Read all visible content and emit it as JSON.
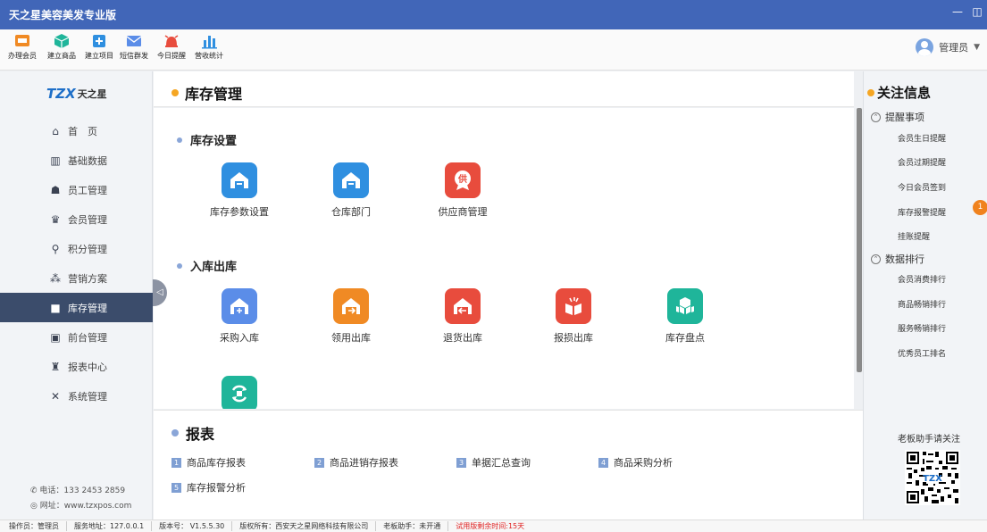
{
  "window": {
    "title": "天之星美容美发专业版",
    "min_label": "—",
    "restore_label": "◫"
  },
  "toolbar": {
    "items": [
      {
        "label": "办理会员",
        "icon": "vip-card-icon"
      },
      {
        "label": "建立商品",
        "icon": "cube-icon"
      },
      {
        "label": "建立项目",
        "icon": "add-item-icon"
      },
      {
        "label": "短信群发",
        "icon": "sms-icon"
      },
      {
        "label": "今日提醒",
        "icon": "alarm-icon"
      },
      {
        "label": "营收统计",
        "icon": "bar-chart-icon"
      }
    ],
    "user": {
      "name": "管理员",
      "caret": "▼"
    }
  },
  "sidebar": {
    "logo_mark": "TZX",
    "logo_text": "天之星",
    "items": [
      {
        "label": "首　页",
        "icon": "home-icon"
      },
      {
        "label": "基础数据",
        "icon": "bars-icon"
      },
      {
        "label": "员工管理",
        "icon": "staff-icon"
      },
      {
        "label": "会员管理",
        "icon": "crown-icon"
      },
      {
        "label": "积分管理",
        "icon": "points-icon"
      },
      {
        "label": "营销方案",
        "icon": "marketing-icon"
      },
      {
        "label": "库存管理",
        "icon": "box-icon"
      },
      {
        "label": "前台管理",
        "icon": "desk-icon"
      },
      {
        "label": "报表中心",
        "icon": "report-icon"
      },
      {
        "label": "系统管理",
        "icon": "tools-icon"
      }
    ],
    "active_index": 6,
    "phone": "电话：133 2453 2859",
    "website": "网址：www.tzxpos.com"
  },
  "main": {
    "title": "库存管理",
    "sections": [
      {
        "title": "库存设置",
        "tiles": [
          {
            "label": "库存参数设置",
            "color": "#2f8fe0"
          },
          {
            "label": "仓库部门",
            "color": "#2f8fe0"
          },
          {
            "label": "供应商管理",
            "color": "#e84c3d",
            "glyph": "供"
          }
        ]
      },
      {
        "title": "入库出库",
        "tiles": [
          {
            "label": "采购入库",
            "color": "#5b8de8"
          },
          {
            "label": "领用出库",
            "color": "#f08a24"
          },
          {
            "label": "退货出库",
            "color": "#e84c3d"
          },
          {
            "label": "报损出库",
            "color": "#e84c3d"
          },
          {
            "label": "库存盘点",
            "color": "#1fb59a"
          },
          {
            "label": "",
            "color": "#1fb59a"
          }
        ]
      }
    ],
    "collapse_label": "◁"
  },
  "reports": {
    "title": "报表",
    "links": [
      {
        "num": "1",
        "label": "商品库存报表"
      },
      {
        "num": "2",
        "label": "商品进销存报表"
      },
      {
        "num": "3",
        "label": "单据汇总查询"
      },
      {
        "num": "4",
        "label": "商品采购分析"
      },
      {
        "num": "5",
        "label": "库存报警分析"
      }
    ]
  },
  "right_panel": {
    "title": "关注信息",
    "group1": {
      "title": "提醒事项",
      "items": [
        "会员生日提醒",
        "会员过期提醒",
        "今日会员签到",
        "库存报警提醒",
        "挂账提醒"
      ],
      "badge": "1"
    },
    "group2": {
      "title": "数据排行",
      "items": [
        "会员消费排行",
        "商品畅销排行",
        "服务畅销排行",
        "优秀员工排名"
      ]
    },
    "qr_label": "老板助手请关注"
  },
  "status": {
    "operator": "操作员：管理员",
    "server": "服务地址：127.0.0.1",
    "version": "版本号： V1.5.5.30",
    "copyright": "版权所有：西安天之星网络科技有限公司",
    "boss": "老板助手：未开通",
    "trial": "试用版剩余时间:15天"
  },
  "colors": {
    "titlebar": "#4166b8",
    "sidebar_active": "#3b4c6b",
    "accent_orange": "#f5a623",
    "warn": "#e02020"
  }
}
